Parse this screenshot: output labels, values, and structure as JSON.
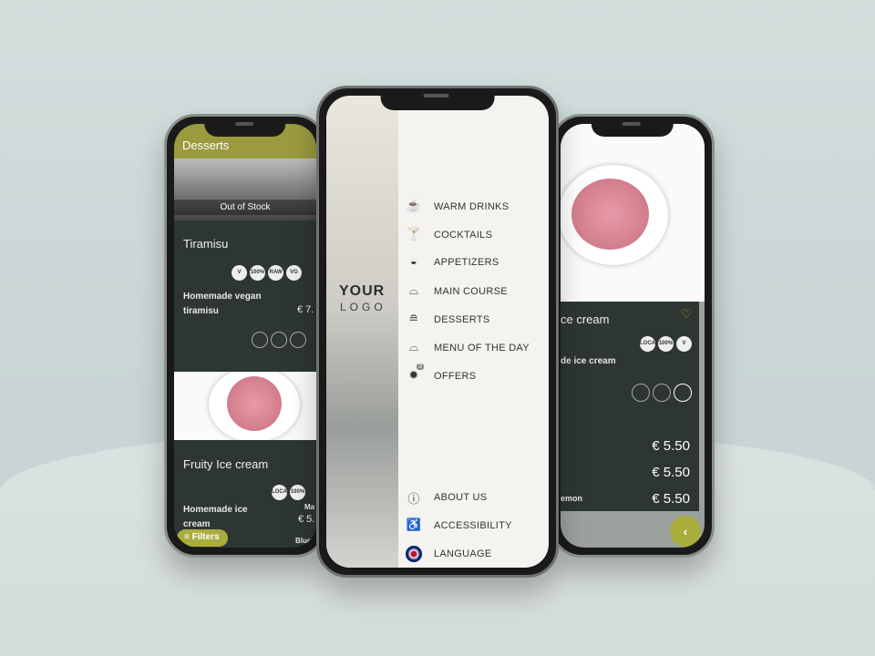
{
  "left_phone": {
    "header_title": "Desserts",
    "items": [
      {
        "status": "Out of Stock",
        "name": "Tiramisu",
        "badges": [
          "V",
          "100%",
          "RAW",
          "VG"
        ],
        "description": "Homemade vegan tiramisu",
        "price": "€ 7."
      },
      {
        "name": "Fruity Ice cream",
        "badges": [
          "LOCAL",
          "100%"
        ],
        "description": "Homemade ice cream",
        "price": "€ 5.",
        "side_label_1": "Ma",
        "side_label_2": "Blueb"
      }
    ],
    "filters_label": "Filters"
  },
  "center_phone": {
    "logo_line1": "YOUR",
    "logo_line2": "LOGO",
    "menu": [
      {
        "icon": "cup-icon",
        "label": "WARM DRINKS"
      },
      {
        "icon": "cocktail-icon",
        "label": "COCKTAILS"
      },
      {
        "icon": "bowl-icon",
        "label": "APPETIZERS"
      },
      {
        "icon": "cloche-icon",
        "label": "MAIN COURSE"
      },
      {
        "icon": "cake-icon",
        "label": "DESSERTS"
      },
      {
        "icon": "cloche-icon",
        "label": "MENU OF THE DAY"
      },
      {
        "icon": "offer-badge-icon",
        "label": "OFFERS",
        "count": "3"
      }
    ],
    "bottom_menu": [
      {
        "icon": "info-icon",
        "label": "ABOUT US"
      },
      {
        "icon": "accessibility-icon",
        "label": "ACCESSIBILITY"
      },
      {
        "icon": "uk-flag-icon",
        "label": "LANGUAGE"
      }
    ]
  },
  "right_phone": {
    "title": "ce cream",
    "badges": [
      "LOCAL",
      "100%",
      "V"
    ],
    "description": "de ice cream",
    "prices": [
      {
        "label": "",
        "price": "€ 5.50"
      },
      {
        "label": "",
        "price": "€ 5.50"
      },
      {
        "label": "emon",
        "price": "€ 5.50"
      }
    ]
  },
  "colors": {
    "accent": "#a9ad3c",
    "card": "#2d3631",
    "menu_bg": "#f4f3ef"
  }
}
